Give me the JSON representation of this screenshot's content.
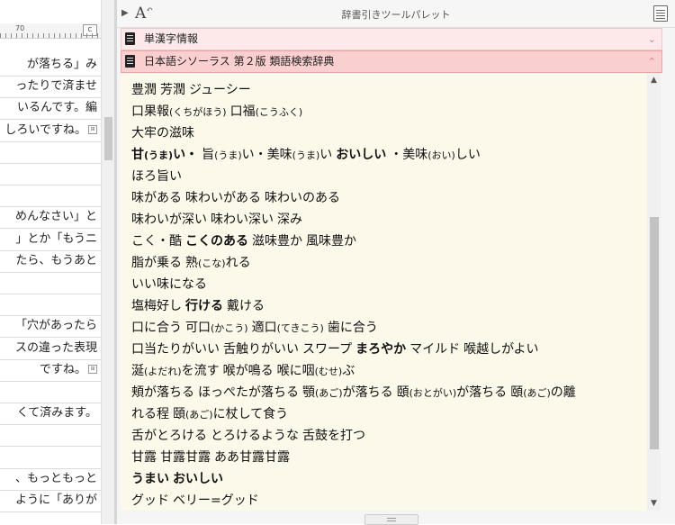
{
  "left_editor": {
    "ruler_number": "70",
    "ruler_box": "C",
    "rows": [
      {
        "text": "が落ちる」み",
        "mark": false
      },
      {
        "text": "ったりで済ませ",
        "mark": false
      },
      {
        "text": "いるんです。編",
        "mark": false
      },
      {
        "text": "しろいですね。",
        "mark": true
      },
      {
        "text": "",
        "mark": false
      },
      {
        "text": "",
        "mark": false
      },
      {
        "text": "",
        "mark": false
      },
      {
        "text": "めんなさい」と",
        "mark": false
      },
      {
        "text": "」とか「もうニ",
        "mark": false
      },
      {
        "text": "たら、もうあと",
        "mark": false
      },
      {
        "text": "",
        "mark": false
      },
      {
        "text": "",
        "mark": false
      },
      {
        "text": "「穴があったら",
        "mark": false
      },
      {
        "text": "スの違った表現",
        "mark": false
      },
      {
        "text": "ですね。",
        "mark": true
      },
      {
        "text": "",
        "mark": false
      },
      {
        "text": "くて済みます。",
        "mark": false
      },
      {
        "text": "",
        "mark": false
      },
      {
        "text": "",
        "mark": false
      },
      {
        "text": "、もっともっと",
        "mark": false
      },
      {
        "text": "ように「ありが",
        "mark": false
      }
    ]
  },
  "palette": {
    "title": "辞書引きツールパレット",
    "font_icon_glyph": "A",
    "dictionaries": [
      {
        "name": "単漢字情報",
        "chevron": "⌄"
      },
      {
        "name": "日本語シソーラス 第２版 類語検索辞典",
        "chevron": "⌃"
      }
    ],
    "entries": [
      [
        {
          "t": "豊潤"
        },
        {
          "t": "芳潤"
        },
        {
          "t": "ジューシー"
        }
      ],
      [
        {
          "t": "口果報",
          "r": "(くちがほう)"
        },
        {
          "t": "口福",
          "r": "(こうふく)"
        }
      ],
      [
        {
          "t": "大牢の滋味"
        }
      ],
      [
        {
          "t": "甘",
          "r": "(うま)",
          "t2": "い・",
          "b": true
        },
        {
          "t": "旨",
          "r": "(うま)",
          "t2": "い・美味",
          "r2": "(うま)",
          "t3": "い"
        },
        {
          "t": "おいしい",
          "b": true
        },
        {
          "t": "・美味",
          "r": "(おい)",
          "t2": "しい"
        }
      ],
      [
        {
          "t": "ほろ旨い"
        }
      ],
      [
        {
          "t": "味がある"
        },
        {
          "t": "味わいがある"
        },
        {
          "t": "味わいのある"
        }
      ],
      [
        {
          "t": "味わいが深い"
        },
        {
          "t": "味わい深い"
        },
        {
          "t": "深み"
        }
      ],
      [
        {
          "t": "こく・酷"
        },
        {
          "t": "こくのある",
          "b": true
        },
        {
          "t": "滋味豊か"
        },
        {
          "t": "風味豊か"
        }
      ],
      [
        {
          "t": "脂が乗る"
        },
        {
          "t": "熟",
          "r": "(こな)",
          "t2": "れる"
        }
      ],
      [
        {
          "t": "いい味になる"
        }
      ],
      [
        {
          "t": "塩梅好し"
        },
        {
          "t": "行ける",
          "b": true
        },
        {
          "t": "戴ける"
        }
      ],
      [
        {
          "t": "口に合う"
        },
        {
          "t": "可口",
          "r": "(かこう)"
        },
        {
          "t": "適口",
          "r": "(てきこう)"
        },
        {
          "t": "歯に合う"
        }
      ],
      [
        {
          "t": "口当たりがいい"
        },
        {
          "t": "舌触りがいい"
        },
        {
          "t": "スワープ"
        },
        {
          "t": "まろやか",
          "b": true
        },
        {
          "t": "マイルド"
        },
        {
          "t": "喉越しがよい"
        }
      ],
      [
        {
          "t": "涎",
          "r": "(よだれ)",
          "t2": "を流す"
        },
        {
          "t": "喉が鳴る"
        },
        {
          "t": "喉に咽",
          "r": "(むせ)",
          "t2": "ぶ"
        }
      ],
      [
        {
          "t": "頬が落ちる"
        },
        {
          "t": "ほっぺたが落ちる"
        },
        {
          "t": "顎",
          "r": "(あご)",
          "t2": "が落ちる"
        },
        {
          "t": "頤",
          "r": "(おとがい)",
          "t2": "が落ちる"
        },
        {
          "t": "頤",
          "r": "(あご)",
          "t2": "の離"
        }
      ],
      [
        {
          "t": "れる程"
        },
        {
          "t": "頤",
          "r": "(あご)",
          "t2": "に杖して食う"
        }
      ],
      [
        {
          "t": "舌がとろける"
        },
        {
          "t": "とろけるような"
        },
        {
          "t": "舌鼓を打つ"
        }
      ],
      [
        {
          "t": "甘露"
        },
        {
          "t": "甘露甘露"
        },
        {
          "t": "ああ甘露甘露"
        }
      ],
      [
        {
          "t": "うまい",
          "b": true
        },
        {
          "t": "おいしい",
          "b": true
        }
      ],
      [
        {
          "t": "グッド"
        },
        {
          "t": "ベリー=グッド"
        }
      ]
    ]
  }
}
